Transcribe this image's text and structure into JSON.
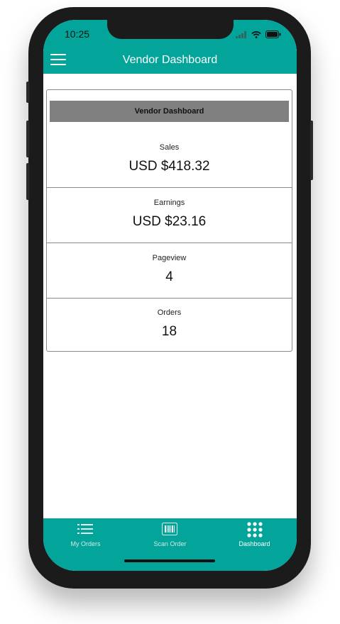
{
  "status_bar": {
    "time": "10:25"
  },
  "header": {
    "title": "Vendor Dashboard"
  },
  "dashboard": {
    "card_title": "Vendor Dashboard",
    "stats": [
      {
        "label": "Sales",
        "value": "USD $418.32"
      },
      {
        "label": "Earnings",
        "value": "USD $23.16"
      },
      {
        "label": "Pageview",
        "value": "4"
      },
      {
        "label": "Orders",
        "value": "18"
      }
    ]
  },
  "tabs": [
    {
      "label": "My Orders",
      "icon": "list-icon"
    },
    {
      "label": "Scan Order",
      "icon": "barcode-icon"
    },
    {
      "label": "Dashboard",
      "icon": "grid-icon",
      "active": true
    }
  ],
  "colors": {
    "accent": "#03a59a",
    "card_header": "#808080"
  }
}
